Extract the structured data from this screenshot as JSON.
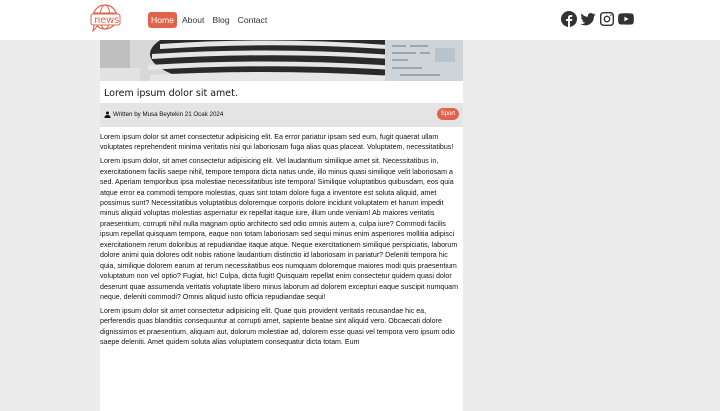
{
  "header": {
    "logo_text": "news",
    "nav": [
      {
        "label": "Home",
        "active": true
      },
      {
        "label": "About",
        "active": false
      },
      {
        "label": "Blog",
        "active": false
      },
      {
        "label": "Contact",
        "active": false
      }
    ],
    "social_icons": [
      "facebook-icon",
      "twitter-icon",
      "instagram-icon",
      "youtube-icon"
    ]
  },
  "article": {
    "title": "Lorem ipsum dolor sit amet.",
    "author_line": "Written by Musa Beytekin 21 Ocak 2024",
    "category": "Sport",
    "paragraphs": [
      "Lorem ipsum dolor sit amet consectetur adipisicing elit. Ea error pariatur ipsam sed eum, fugit quaerat ullam voluptates reprehenderit minima veritatis nisi qui laboriosam fuga alias quas placeat. Voluptatem, necessitatibus!",
      "Lorem ipsum dolor, sit amet consectetur adipisicing elit. Vel laudantium similique amet sit. Necessitatibus in, exercitationem facilis saepe nihil, tempore tempora dicta natus unde, illo minus quasi similique velit laboriosam a sed. Aperiam temporibus ipsa molestiae necessitatibus iste tempora! Similique voluptatibus quibusdam, eos quia atque error ea commodi tempore molestias, quas sint totam dolore fuga a inventore est soluta aliquid, amet possimus sunt? Necessitatibus voluptatibus doloremque corporis dolore incidunt voluptatem et harum impedit minus aliquid voluptas molestias aspernatur ex repellat itaque iure, illum unde veniam! Ab maiores veritatis praesentium, corrupti nihil nulla magnam optio architecto sed odio omnis autem a, culpa iure? Commodi facilis ipsum repellat quisquam tempora, eaque non totam laboriosam sed sequi minus enim asperiores mollitia adipisci exercitationem rerum doloribus at repudiandae itaque atque. Neque exercitationem similique perspiciatis, laborum dolore animi quia dolores odit nobis ratione laudantium distinctio id laboriosam in pariatur? Deleniti tempora hic quia, similique dolorem earum at rerum necessitatibus eos numquam doloremque maiores modi quis praesentium voluptatum non vel optio? Fugiat, hic! Culpa, dicta fugit! Quisquam repellat enim consectetur quidem quasi dolor deserunt quae assumenda veritatis voluptate libero minus laborum ad dolorem excepturi eaque suscipit numquam neque, deleniti commodi? Omnis aliquid iusto officia repudiandae sequi!",
      "Lorem ipsum dolor sit amet consectetur adipisicing elit. Quae quis provident veritatis recusandae hic ea, perferendis quas blanditiis consequuntur at corrupti amet, sapiente beatae sint aliquid vero. Obcaecati dolore dignissimos et praesentium, aliquam aut, dolorum molestiae ad, dolorem esse quasi vel tempora vero ipsum odio saepe deleniti. Amet quidem soluta alias voluptatem consequatur dicta totam. Eum"
    ]
  },
  "colors": {
    "accent": "#e0644b",
    "page_bg": "#ececec",
    "meta_bg": "#e4e4e4"
  }
}
